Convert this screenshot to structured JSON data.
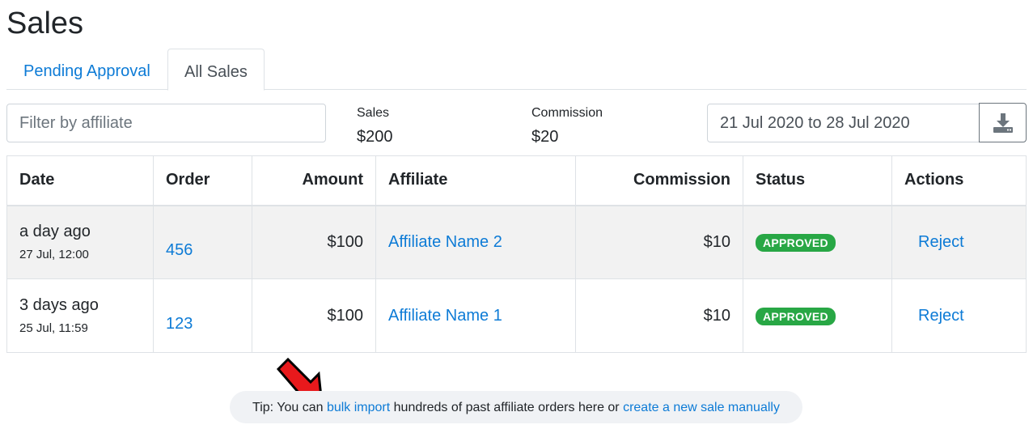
{
  "page": {
    "title": "Sales"
  },
  "tabs": [
    {
      "label": "Pending Approval",
      "active": false
    },
    {
      "label": "All Sales",
      "active": true
    }
  ],
  "filter": {
    "placeholder": "Filter by affiliate",
    "value": ""
  },
  "summary": {
    "sales_label": "Sales",
    "sales_value": "$200",
    "commission_label": "Commission",
    "commission_value": "$20"
  },
  "date_range": {
    "value": "21 Jul 2020 to 28 Jul 2020"
  },
  "download": {
    "icon": "download-icon"
  },
  "table": {
    "headers": {
      "date": "Date",
      "order": "Order",
      "amount": "Amount",
      "affiliate": "Affiliate",
      "commission": "Commission",
      "status": "Status",
      "actions": "Actions"
    },
    "rows": [
      {
        "when": "a day ago",
        "datetime": "27 Jul, 12:00",
        "order": "456",
        "amount": "$100",
        "affiliate": "Affiliate Name 2",
        "commission": "$10",
        "status": "APPROVED",
        "action": "Reject"
      },
      {
        "when": "3 days ago",
        "datetime": "25 Jul, 11:59",
        "order": "123",
        "amount": "$100",
        "affiliate": "Affiliate Name 1",
        "commission": "$10",
        "status": "APPROVED",
        "action": "Reject"
      }
    ]
  },
  "tip": {
    "prefix": "Tip: You can ",
    "bulk_import": "bulk import",
    "middle": " hundreds of past affiliate orders here or ",
    "create_sale": "create a new sale manually"
  },
  "colors": {
    "link": "#0d7bd6",
    "approved": "#28a745",
    "arrow": "#e8191c"
  }
}
